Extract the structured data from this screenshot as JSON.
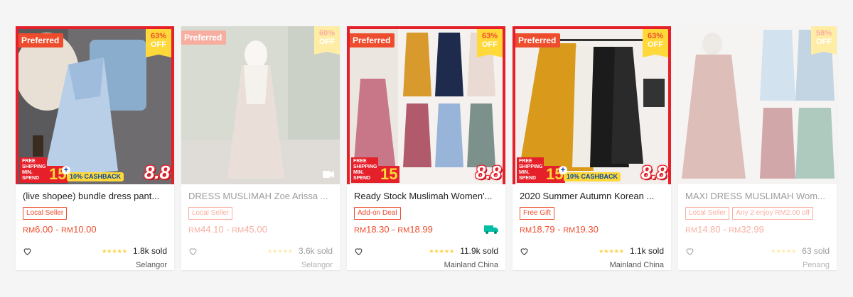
{
  "colors": {
    "accent": "#ee4d2d",
    "promo_red": "#e5202b",
    "promo_yellow": "#ffd839",
    "star": "#ffce3d"
  },
  "products": [
    {
      "title": "(live shopee) bundle dress pant...",
      "preferred": "Preferred",
      "discount_pct": "63%",
      "discount_off": "OFF",
      "badges": [
        "Local Seller"
      ],
      "price_cur": "RM",
      "price_low": "6.00",
      "price_sep": " - ",
      "price_cur2": "RM",
      "price_high": "10.00",
      "rating_stars": "★★★★★",
      "sold": "1.8k sold",
      "location": "Selangor",
      "promo": {
        "free_shipping": "FREE SHIPPING MIN. SPEND",
        "min_spend": "15",
        "plus": "+",
        "cashback": "10% CASHBACK",
        "event": "8.8"
      }
    },
    {
      "title": "DRESS MUSLIMAH Zoe Arissa ...",
      "preferred": "Preferred",
      "discount_pct": "60%",
      "discount_off": "OFF",
      "badges": [
        "Local Seller"
      ],
      "price_cur": "RM",
      "price_low": "44.10",
      "price_sep": " - ",
      "price_cur2": "RM",
      "price_high": "45.00",
      "rating_stars": "★★★★★",
      "sold": "3.6k sold",
      "location": "Selangor"
    },
    {
      "title": "Ready Stock Muslimah Women'...",
      "preferred": "Preferred",
      "discount_pct": "63%",
      "discount_off": "OFF",
      "badges": [
        "Add-on Deal"
      ],
      "price_cur": "RM",
      "price_low": "18.30",
      "price_sep": " - ",
      "price_cur2": "RM",
      "price_high": "18.99",
      "rating_stars": "★★★★★",
      "sold": "11.9k sold",
      "location": "Mainland China",
      "promo": {
        "free_shipping": "FREE SHIPPING MIN. SPEND",
        "min_spend": "15",
        "event": "8.8"
      }
    },
    {
      "title": "2020 Summer Autumn Korean ...",
      "preferred": "Preferred",
      "discount_pct": "63%",
      "discount_off": "OFF",
      "badges": [
        "Free Gift"
      ],
      "price_cur": "RM",
      "price_low": "18.79",
      "price_sep": " - ",
      "price_cur2": "RM",
      "price_high": "19.30",
      "rating_stars": "★★★★★",
      "sold": "1.1k sold",
      "location": "Mainland China",
      "promo": {
        "free_shipping": "FREE SHIPPING MIN. SPEND",
        "min_spend": "15",
        "plus": "+",
        "cashback": "10% CASHBACK",
        "event": "8.8"
      }
    },
    {
      "title": "MAXI DRESS MUSLIMAH Wom...",
      "discount_pct": "58%",
      "discount_off": "OFF",
      "badges": [
        "Local Seller",
        "Any 2 enjoy RM2.00 off"
      ],
      "price_cur": "RM",
      "price_low": "14.80",
      "price_sep": " - ",
      "price_cur2": "RM",
      "price_high": "32.99",
      "rating_stars": "★★★★★",
      "sold": "63 sold",
      "location": "Penang"
    }
  ]
}
